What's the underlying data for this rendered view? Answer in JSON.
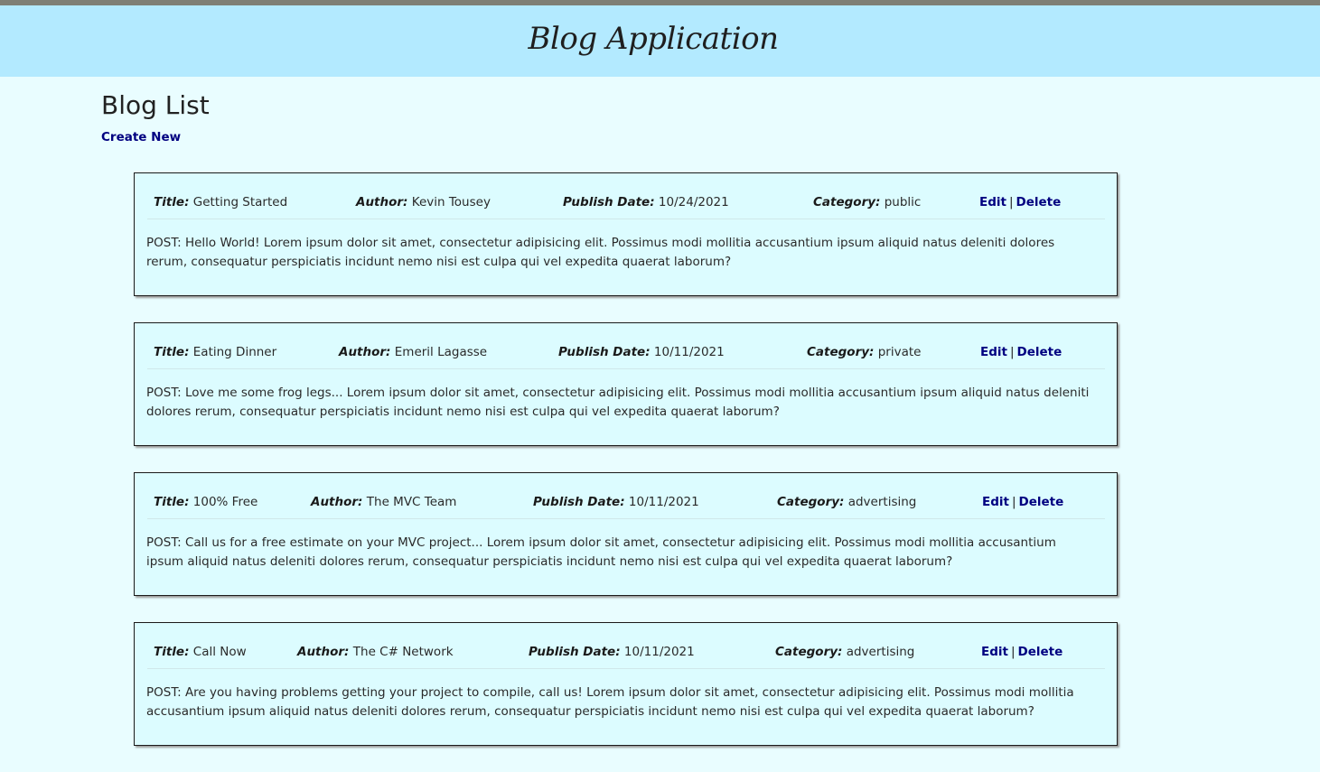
{
  "header": {
    "title": "Blog Application"
  },
  "page": {
    "heading": "Blog List",
    "create_new": "Create New"
  },
  "labels": {
    "title": "Title:",
    "author": "Author:",
    "publish_date": "Publish Date:",
    "category": "Category:",
    "edit": "Edit",
    "separator": "|",
    "delete": "Delete"
  },
  "posts": [
    {
      "title": "Getting Started",
      "author": "Kevin Tousey",
      "publish_date": "10/24/2021",
      "category": "public",
      "body": "POST: Hello World! Lorem ipsum dolor sit amet, consectetur adipisicing elit. Possimus modi mollitia accusantium ipsum aliquid natus deleniti dolores rerum, consequatur perspiciatis incidunt nemo nisi est culpa qui vel expedita quaerat laborum?"
    },
    {
      "title": "Eating Dinner",
      "author": "Emeril Lagasse",
      "publish_date": "10/11/2021",
      "category": "private",
      "body": "POST: Love me some frog legs... Lorem ipsum dolor sit amet, consectetur adipisicing elit. Possimus modi mollitia accusantium ipsum aliquid natus deleniti dolores rerum, consequatur perspiciatis incidunt nemo nisi est culpa qui vel expedita quaerat laborum?"
    },
    {
      "title": "100% Free",
      "author": "The MVC Team",
      "publish_date": "10/11/2021",
      "category": "advertising",
      "body": "POST: Call us for a free estimate on your MVC project... Lorem ipsum dolor sit amet, consectetur adipisicing elit. Possimus modi mollitia accusantium ipsum aliquid natus deleniti dolores rerum, consequatur perspiciatis incidunt nemo nisi est culpa qui vel expedita quaerat laborum?"
    },
    {
      "title": "Call Now",
      "author": "The C# Network",
      "publish_date": "10/11/2021",
      "category": "advertising",
      "body": "POST: Are you having problems getting your project to compile, call us! Lorem ipsum dolor sit amet, consectetur adipisicing elit. Possimus modi mollitia accusantium ipsum aliquid natus deleniti dolores rerum, consequatur perspiciatis incidunt nemo nisi est culpa qui vel expedita quaerat laborum?"
    }
  ]
}
